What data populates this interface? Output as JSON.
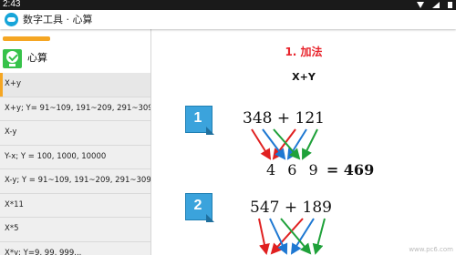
{
  "status_bar": {
    "time": "2:43"
  },
  "app_bar": {
    "title": "数字工具 · 心算"
  },
  "sidebar": {
    "category": "心算",
    "items": [
      {
        "label": "X+y",
        "active": true
      },
      {
        "label": "X+y; Y= 91~109, 191~209, 291~309",
        "active": false
      },
      {
        "label": "X-y",
        "active": false
      },
      {
        "label": "Y-x; Y = 100, 1000, 10000",
        "active": false
      },
      {
        "label": "X-y; Y = 91~109, 191~209, 291~309",
        "active": false
      },
      {
        "label": "X*11",
        "active": false
      },
      {
        "label": "X*5",
        "active": false
      },
      {
        "label": "X*y; Y=9, 99, 999...",
        "active": false
      }
    ]
  },
  "main": {
    "section_title": "1. 加法",
    "formula": "X+Y",
    "steps": [
      {
        "number": "1",
        "problem": "348 + 121",
        "answer_digits": "4 6 9",
        "answer_eq": "= ",
        "answer_bold": "469"
      },
      {
        "number": "2",
        "problem": "547 + 189"
      }
    ]
  },
  "watermark": "www.pc6.com",
  "colors": {
    "accent_orange": "#f5a623",
    "title_red": "#e8242c",
    "badge_blue": "#3ba3dc",
    "arrow_red": "#e02020",
    "arrow_blue": "#1e78d2",
    "arrow_green": "#1fa13a"
  }
}
